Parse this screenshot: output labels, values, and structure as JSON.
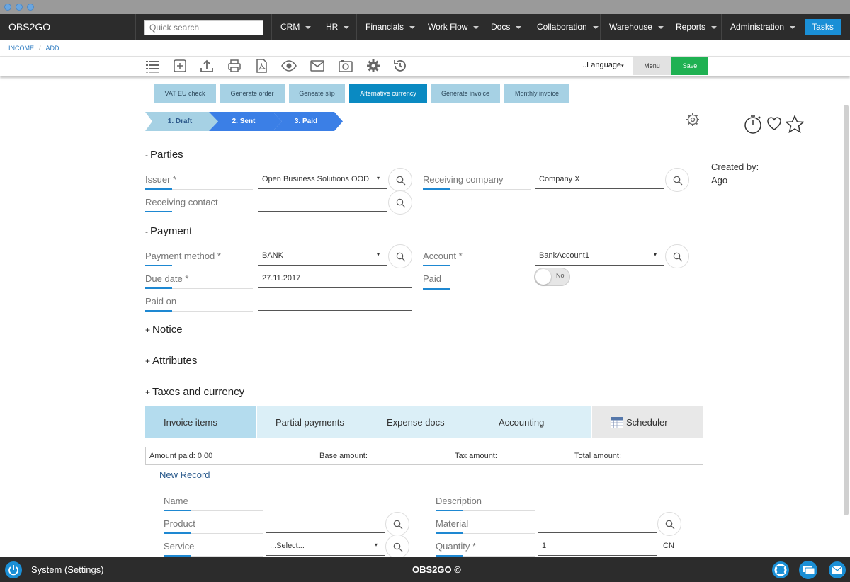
{
  "app": {
    "brand": "OBS2GO",
    "search_placeholder": "Quick search",
    "tasks_label": "Tasks"
  },
  "nav": [
    "CRM",
    "HR",
    "Financials",
    "Work Flow",
    "Docs",
    "Collaboration",
    "Warehouse",
    "Reports",
    "Administration"
  ],
  "breadcrumb": [
    "INCOME",
    "ADD"
  ],
  "toolbar": {
    "language_label": "..Language",
    "menu_label": "Menu",
    "save_label": "Save",
    "icons": [
      "list-icon",
      "add-icon",
      "upload-icon",
      "print-icon",
      "pdf-icon",
      "view-icon",
      "email-icon",
      "camera-icon",
      "settings-icon",
      "history-icon"
    ]
  },
  "actions": [
    "VAT EU check",
    "Generate order",
    "Geneate slip",
    "Alternative currency",
    "Generate invoice",
    "Monthly invoice"
  ],
  "steps": [
    "1. Draft",
    "2. Sent",
    "3. Paid"
  ],
  "sections": {
    "parties": {
      "title": "Parties",
      "toggle": "-"
    },
    "payment": {
      "title": "Payment",
      "toggle": "-"
    },
    "notice": {
      "title": "Notice",
      "toggle": "+"
    },
    "attributes": {
      "title": "Attributes",
      "toggle": "+"
    },
    "taxes": {
      "title": "Taxes and currency",
      "toggle": "+"
    }
  },
  "fields": {
    "issuer": {
      "label": "Issuer *",
      "value": "Open Business Solutions OOD"
    },
    "receiving_company": {
      "label": "Receiving company",
      "value": "Company X"
    },
    "receiving_contact": {
      "label": "Receiving contact",
      "value": ""
    },
    "payment_method": {
      "label": "Payment method *",
      "value": "BANK"
    },
    "account": {
      "label": "Account *",
      "value": "BankAccount1"
    },
    "due_date": {
      "label": "Due date *",
      "value": "27.11.2017"
    },
    "paid": {
      "label": "Paid",
      "toggle_value": "No"
    },
    "paid_on": {
      "label": "Paid on",
      "value": ""
    }
  },
  "right_panel": {
    "created_by_label": "Created by:",
    "created_ago": "Ago"
  },
  "tabs": [
    "Invoice items",
    "Partial payments",
    "Expense docs",
    "Accounting",
    "Scheduler"
  ],
  "summary": {
    "amount_paid": "Amount paid: 0.00",
    "base_amount": "Base amount:",
    "tax_amount": "Tax amount:",
    "total_amount": "Total amount:"
  },
  "new_record": {
    "title": "New Record",
    "name_label": "Name",
    "description_label": "Description",
    "product_label": "Product",
    "material_label": "Material",
    "service_label": "Service",
    "service_value": "...Select...",
    "quantity_label": "Quantity *",
    "quantity_value": "1",
    "unit": "CN"
  },
  "footer": {
    "system_label": "System (Settings)",
    "copyright": "OBS2GO ©"
  }
}
